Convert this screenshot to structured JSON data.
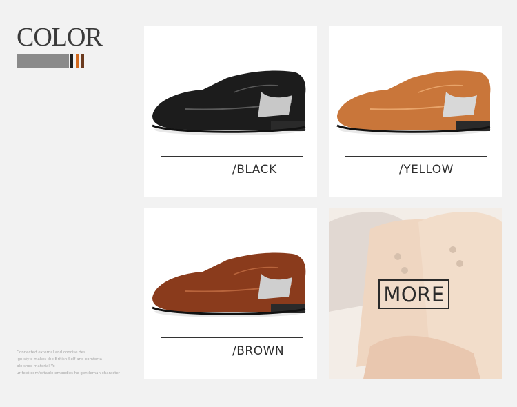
{
  "heading": {
    "title": "COLOR"
  },
  "colors": {
    "heading_bar": "#8a8a8a",
    "stripe_black": "#1f1f1f",
    "stripe_orange": "#d2691e",
    "stripe_brown": "#6b3a1e"
  },
  "description": [
    "Connected external and concise des",
    "ign style makes the British Self and comforta",
    "ble shoe material Yo",
    "ur feet comfortable embodies he gentleman character"
  ],
  "products": [
    {
      "label": "/BLACK",
      "color": "#1c1c1c",
      "highlight": "#5a5a5a"
    },
    {
      "label": "/YELLOW",
      "color": "#c9763a",
      "highlight": "#e8a46a"
    },
    {
      "label": "/BROWN",
      "color": "#8a3b1c",
      "highlight": "#b8643c"
    }
  ],
  "more": {
    "label": "MORE"
  }
}
